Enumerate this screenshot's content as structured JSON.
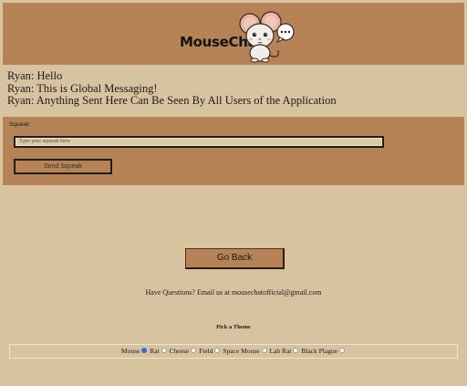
{
  "header": {
    "brand": "MouseChat"
  },
  "messages": [
    {
      "text": "Ryan: Hello"
    },
    {
      "text": "Ryan: This is Global Messaging!"
    },
    {
      "text": "Ryan: Anything Sent Here Can Be Seen By All Users of the Application"
    }
  ],
  "compose": {
    "label": "Squeak:",
    "placeholder": "Type your squeak here",
    "send_label": "Send Squeak"
  },
  "back_label": "Go Back",
  "contact": "Have Questions? Email us at mousechatofficial@gmail.com",
  "themes": {
    "title": "Pick a Theme",
    "selected": "Mouse",
    "options": [
      "Mouse",
      "Rat",
      "Cheese",
      "Field",
      "Space Mouse",
      "Lab Rat",
      "Black Plague"
    ]
  },
  "colors": {
    "background": "#d8c3a0",
    "accent": "#b68356",
    "radio_selected": "#2f6fd6"
  }
}
